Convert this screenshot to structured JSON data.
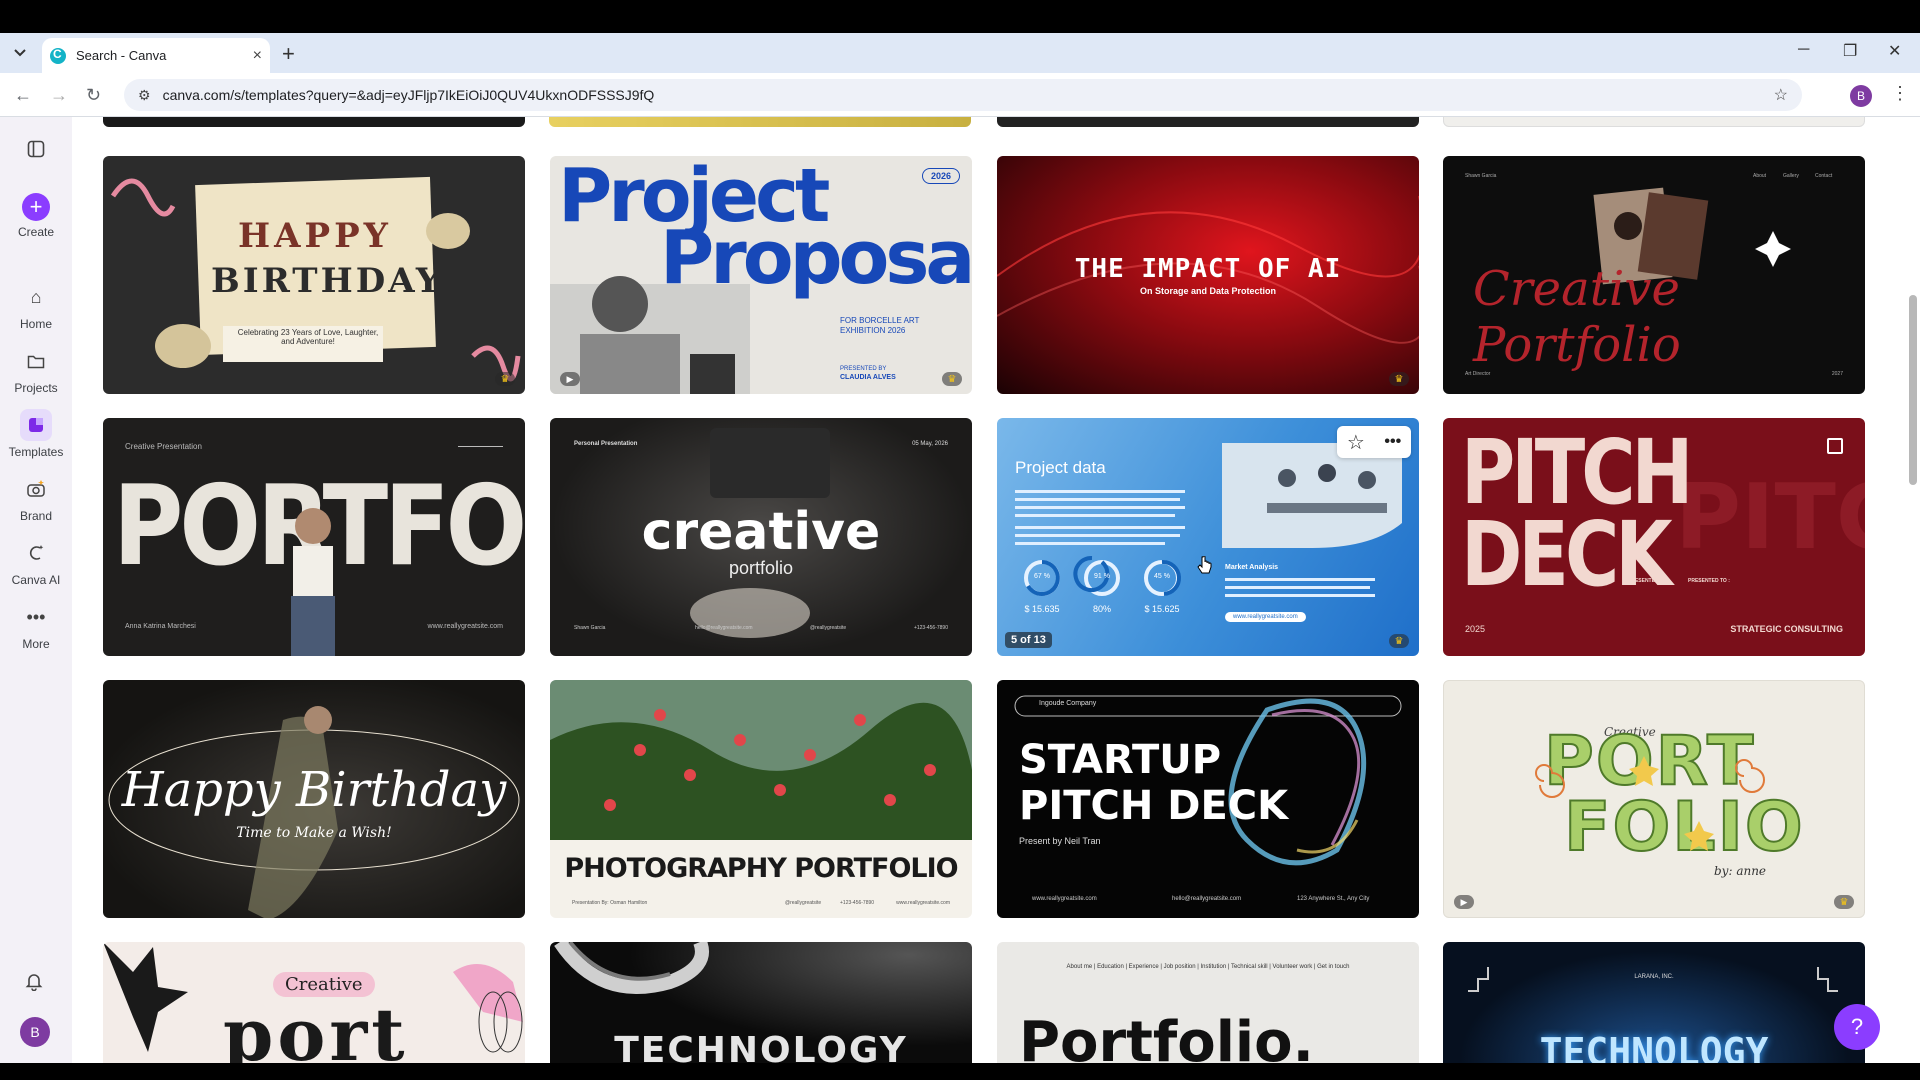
{
  "browser": {
    "tab_title": "Search - Canva",
    "new_tab": "+",
    "url": "canva.com/s/templates?query=&adj=eyJFljp7IkEiOiJ0QUV4UkxnODFSSSJ9fQ",
    "profile_initial": "B",
    "close_tab": "×",
    "min": "─",
    "restore": "❐",
    "close": "✕"
  },
  "sidebar": {
    "items": [
      {
        "label": "Create"
      },
      {
        "label": "Home"
      },
      {
        "label": "Projects"
      },
      {
        "label": "Templates"
      },
      {
        "label": "Brand"
      },
      {
        "label": "Canva AI"
      },
      {
        "label": "More"
      }
    ],
    "avatar_initial": "B"
  },
  "cards": [
    {
      "line1": "HAPPY",
      "line2": "BIRTHDAY",
      "sub": "Celebrating 23 Years of Love, Laughter, and Adventure!"
    },
    {
      "title1": "Project",
      "title2": "Proposal",
      "year": "2026",
      "sub1": "FOR BORCELLE ART",
      "sub2": "EXHIBITION 2026",
      "presented": "PRESENTED BY",
      "name": "CLAUDIA ALVES"
    },
    {
      "title": "THE IMPACT OF AI",
      "sub": "On Storage and Data Protection"
    },
    {
      "title": "Creative Portfolio",
      "top1": "Shawn Garcia",
      "nav1": "About",
      "nav2": "Gallery",
      "nav3": "Contact",
      "foot1": "Art Director",
      "foot2": "2027"
    },
    {
      "title": "PORTFOLIO",
      "top": "Creative Presentation",
      "name": "Anna Katrina Marchesi",
      "site": "www.reallygreatsite.com"
    },
    {
      "title": "creative",
      "sub": "portfolio",
      "top": "Personal Presentation",
      "date": "05 May, 2026",
      "name": "Shawn Garcia",
      "email": "hello@reallygreatsite.com",
      "handle": "@reallygreatsite",
      "phone": "+123-456-7890"
    },
    {
      "title": "Project data",
      "stat1": "67 %",
      "stat2": "91 %",
      "stat3": "45 %",
      "val1": "$ 15.635",
      "val2": "80%",
      "val3": "$ 15.625",
      "market": "Market Analysis",
      "site": "www.reallygreatsite.com",
      "counter": "5 of 13"
    },
    {
      "title1": "PITCH",
      "title2": "DECK",
      "year": "2025",
      "firm": "STRATEGIC CONSULTING",
      "presented_by": "PRESENTED BY :",
      "presented_to": "PRESENTED TO :"
    },
    {
      "title": "Happy Birthday",
      "sub": "Time to Make a Wish!"
    },
    {
      "title": "PHOTOGRAPHY PORTFOLIO",
      "credit": "Presentation By: Osman Hamilton",
      "handle": "@reallygreatsite",
      "phone": "+123-456-7890",
      "site": "www.reallygreatsite.com"
    },
    {
      "company": "Ingoude Company",
      "title1": "STARTUP",
      "title2": "PITCH DECK",
      "presenter": "Present by Neil Tran",
      "site": "www.reallygreatsite.com",
      "email": "hello@reallygreatsite.com",
      "addr": "123 Anywhere St., Any City"
    },
    {
      "top": "Creative",
      "title1": "PORT",
      "title2": "FOLIO",
      "by": "by: anne"
    },
    {
      "badge": "Creative",
      "title": "port"
    },
    {
      "title": "TECHNOLOGY"
    },
    {
      "nav": "About me | Education | Experience | Job position | Institution | Technical skill | Volunteer work | Get in touch",
      "title": "Portfolio."
    },
    {
      "company": "LARANA, INC.",
      "title": "TECHNOLOGY"
    }
  ],
  "help": "?"
}
